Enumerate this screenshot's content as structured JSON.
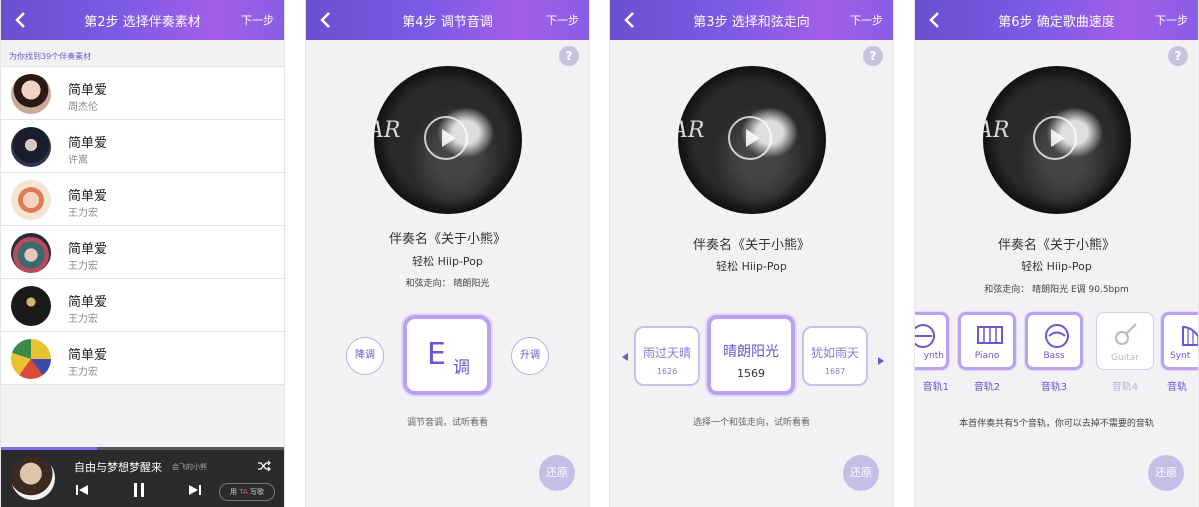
{
  "panel1": {
    "title": "第2步 选择伴奏素材",
    "next": "下一步",
    "found_text": "为你找到39个伴奏素材",
    "songs": [
      {
        "name": "简单爱",
        "artist": "周杰伦"
      },
      {
        "name": "简单爱",
        "artist": "许嵩"
      },
      {
        "name": "简单爱",
        "artist": "王力宏"
      },
      {
        "name": "简单爱",
        "artist": "王力宏"
      },
      {
        "name": "简单爱",
        "artist": "王力宏"
      },
      {
        "name": "简单爱",
        "artist": "王力宏"
      }
    ],
    "player": {
      "title": "自由与梦想梦醒来",
      "subtitle": "会飞的小熊",
      "use_prefix": "用",
      "use_ta": "TA",
      "use_suffix": "写歌",
      "progress": 0.34
    }
  },
  "panel2": {
    "title": "第4步 调节音调",
    "next": "下一步",
    "help": "?",
    "accompaniment": "伴奏名《关于小熊》",
    "style": "轻松 Hiip-Pop",
    "chord_info": "和弦走向：  晴朗阳光",
    "key_letter": "E",
    "key_suffix": "调",
    "down": "降调",
    "up": "升调",
    "hint": "调节音调，试听看看",
    "restore": "还原",
    "album_text": "AR"
  },
  "panel3": {
    "title": "第3步 选择和弦走向",
    "next": "下一步",
    "help": "?",
    "accompaniment": "伴奏名《关于小熊》",
    "style": "轻松 Hiip-Pop",
    "chords": [
      {
        "name": "雨过天晴",
        "count": "1626"
      },
      {
        "name": "晴朗阳光",
        "count": "1569"
      },
      {
        "name": "犹如雨天",
        "count": "1687"
      }
    ],
    "hint": "选择一个和弦走向，试听看看",
    "restore": "还原",
    "album_text": "AR"
  },
  "panel4": {
    "title": "第6步 确定歌曲速度",
    "next": "下一步",
    "help": "?",
    "accompaniment": "伴奏名《关于小熊》",
    "style": "轻松 Hiip-Pop",
    "chord_info": "和弦走向：  晴朗阳光    E调   90.5bpm",
    "tracks": [
      {
        "icon": "synth",
        "name": "ynth",
        "label": "音轨1",
        "enabled": true
      },
      {
        "icon": "piano",
        "name": "Piano",
        "label": "音轨2",
        "enabled": true
      },
      {
        "icon": "bass",
        "name": "Bass",
        "label": "音轨3",
        "enabled": true
      },
      {
        "icon": "guitar",
        "name": "Guitar",
        "label": "音轨4",
        "enabled": false
      },
      {
        "icon": "harp",
        "name": "Synt",
        "label": "音轨",
        "enabled": true
      }
    ],
    "hint": "本首伴奏共有5个音轨，你可以去掉不需要的音轨",
    "restore": "还原",
    "album_text": "AR"
  },
  "colors": {
    "accent": "#6a55d6",
    "header_start": "#6a4fd0",
    "header_end": "#a35ee8",
    "border": "#b9a2f0"
  }
}
